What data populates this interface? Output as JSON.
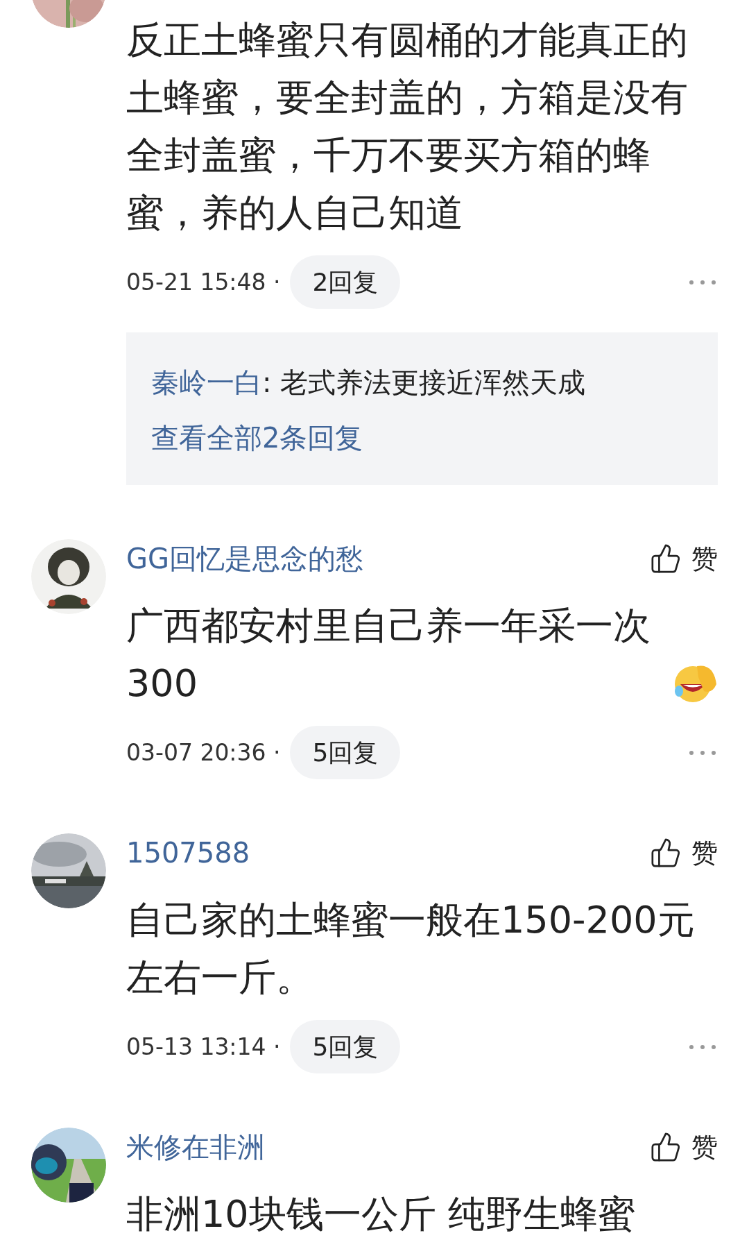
{
  "comments": [
    {
      "body": "反正土蜂蜜只有圆桶的才能真正的土蜂蜜，要全封盖的，方箱是没有全封盖蜜，千万不要买方箱的蜂蜜，养的人自己知道",
      "trailing_emoji": false,
      "time": "05-21 15:48 ·",
      "replies_button": "2回复",
      "reply_preview": {
        "author": "秦岭一白",
        "text": ": 老式养法更接近浑然天成",
        "view_all": "查看全部2条回复"
      }
    },
    {
      "name": "GG回忆是思念的愁",
      "like_label": "赞",
      "body": "广西都安村里自己养一年采一次300",
      "trailing_emoji": true,
      "time": "03-07 20:36 ·",
      "replies_button": "5回复"
    },
    {
      "name": "1507588",
      "like_label": "赞",
      "body": "自己家的土蜂蜜一般在150-200元左右一斤。",
      "trailing_emoji": false,
      "time": "05-13 13:14 ·",
      "replies_button": "5回复"
    },
    {
      "name": "米修在非洲",
      "like_label": "赞",
      "body": "非洲10块钱一公斤 纯野生蜂蜜",
      "trailing_emoji": false
    }
  ]
}
